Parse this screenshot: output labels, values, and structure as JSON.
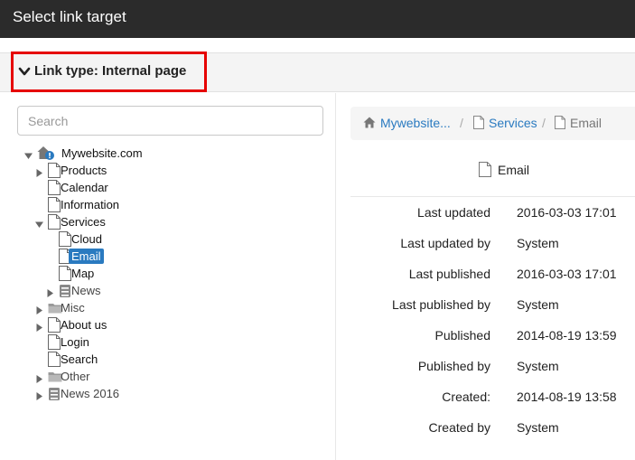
{
  "window": {
    "title": "Select link target"
  },
  "link_type": {
    "label": "Link type: Internal page"
  },
  "search": {
    "placeholder": "Search",
    "value": ""
  },
  "tree": [
    {
      "label": "Mywebsite.com",
      "icon": "site-home-icon",
      "toggle": "expanded",
      "depth": 0
    },
    {
      "label": "Products",
      "icon": "page-icon",
      "toggle": "collapsed",
      "depth": 1
    },
    {
      "label": "Calendar",
      "icon": "page-icon",
      "toggle": "none",
      "depth": 1
    },
    {
      "label": "Information",
      "icon": "page-icon",
      "toggle": "none",
      "depth": 1
    },
    {
      "label": "Services",
      "icon": "page-icon",
      "toggle": "expanded",
      "depth": 1
    },
    {
      "label": "Cloud",
      "icon": "page-icon",
      "toggle": "none",
      "depth": 2
    },
    {
      "label": "Email",
      "icon": "page-icon",
      "toggle": "none",
      "depth": 2,
      "selected": true
    },
    {
      "label": "Map",
      "icon": "page-icon",
      "toggle": "none",
      "depth": 2
    },
    {
      "label": "News",
      "icon": "archive-icon",
      "toggle": "collapsed",
      "depth": 2,
      "dim": true
    },
    {
      "label": "Misc",
      "icon": "folder-icon",
      "toggle": "collapsed",
      "depth": 1,
      "dim": true
    },
    {
      "label": "About us",
      "icon": "page-icon",
      "toggle": "collapsed",
      "depth": 1
    },
    {
      "label": "Login",
      "icon": "page-icon",
      "toggle": "none",
      "depth": 1
    },
    {
      "label": "Search",
      "icon": "page-icon",
      "toggle": "none",
      "depth": 1
    },
    {
      "label": "Other",
      "icon": "folder-icon",
      "toggle": "collapsed",
      "depth": 1,
      "dim": true
    },
    {
      "label": "News 2016",
      "icon": "archive-icon",
      "toggle": "collapsed",
      "depth": 1,
      "dim": true
    }
  ],
  "breadcrumb": {
    "home": "Mywebsite...",
    "separator": "/",
    "parent": "Services",
    "current": "Email"
  },
  "detail": {
    "title": "Email",
    "properties": [
      {
        "label": "Last updated",
        "value": "2016-03-03 17:01"
      },
      {
        "label": "Last updated by",
        "value": "System"
      },
      {
        "label": "Last published",
        "value": "2016-03-03 17:01"
      },
      {
        "label": "Last published by",
        "value": "System"
      },
      {
        "label": "Published",
        "value": "2014-08-19 13:59"
      },
      {
        "label": "Published by",
        "value": "System"
      },
      {
        "label": "Created:",
        "value": "2014-08-19 13:58"
      },
      {
        "label": "Created by",
        "value": "System"
      }
    ]
  },
  "colors": {
    "accent": "#2a7ac0",
    "highlight_box": "#e60000",
    "titlebar": "#2b2b2b"
  }
}
